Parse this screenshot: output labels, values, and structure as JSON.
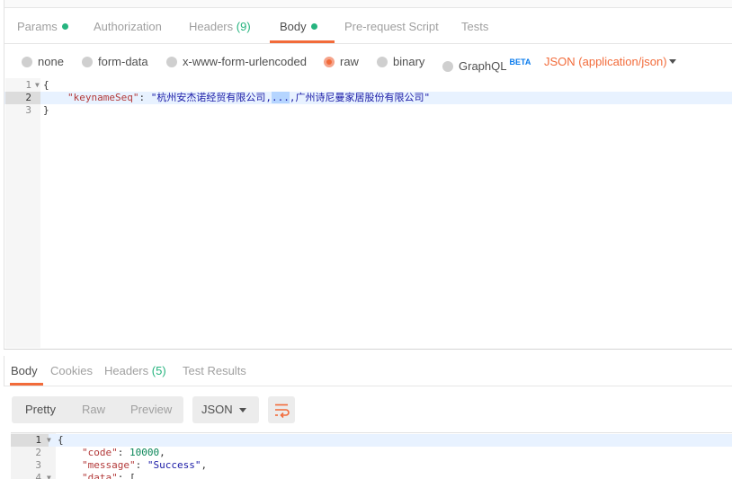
{
  "request_tabs": [
    {
      "label": "Params",
      "dot": true
    },
    {
      "label": "Authorization"
    },
    {
      "label": "Headers",
      "count": "(9)"
    },
    {
      "label": "Body",
      "dot": true,
      "active": true
    },
    {
      "label": "Pre-request Script"
    },
    {
      "label": "Tests"
    }
  ],
  "body_types": {
    "options": [
      "none",
      "form-data",
      "x-www-form-urlencoded",
      "raw",
      "binary",
      "GraphQL"
    ],
    "selected": "raw",
    "graphql_badge": "BETA",
    "content_type": "JSON (application/json)"
  },
  "request_editor": {
    "line_numbers": [
      "1",
      "2",
      "3"
    ],
    "open_brace": "{",
    "key": "\"keynameSeq\"",
    "colon": ": ",
    "value_before_selection": "\"杭州安杰诺经贸有限公司,",
    "value_selected": "...",
    "value_after_selection": ",广州诗尼曼家居股份有限公司\"",
    "close_brace": "}"
  },
  "response_tabs": [
    {
      "label": "Body",
      "active": true
    },
    {
      "label": "Cookies"
    },
    {
      "label": "Headers",
      "count": "(5)"
    },
    {
      "label": "Test Results"
    }
  ],
  "response_view": {
    "modes": [
      "Pretty",
      "Raw",
      "Preview"
    ],
    "selected_mode": "Pretty",
    "format": "JSON",
    "wrap_icon": "wrap-lines-icon"
  },
  "response_editor": {
    "line_numbers": [
      "1",
      "2",
      "3",
      "4"
    ],
    "line1": "{",
    "code_key": "\"code\"",
    "code_value": "10000",
    "message_key": "\"message\"",
    "message_value": "\"Success\"",
    "data_key": "\"data\"",
    "data_open": "["
  },
  "colors": {
    "accent": "#f26b3a",
    "success": "#26b47f",
    "beta": "#097bed"
  }
}
